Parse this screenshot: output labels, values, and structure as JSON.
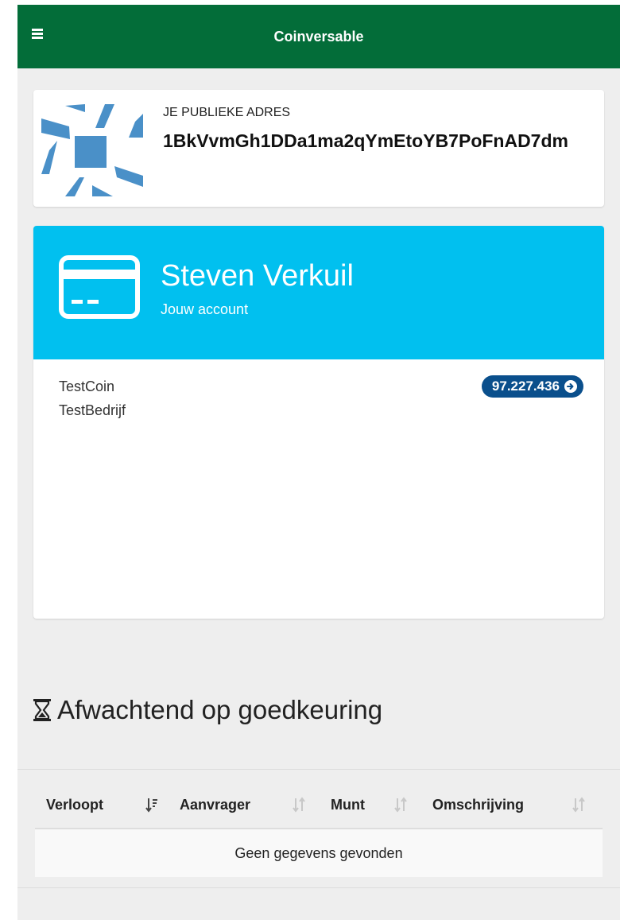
{
  "header": {
    "title": "Coinversable"
  },
  "address": {
    "label": "JE PUBLIEKE ADRES",
    "value": "1BkVvmGh1DDa1ma2qYmEtoYB7PoFnAD7dm"
  },
  "account": {
    "name": "Steven Verkuil",
    "subtitle": "Jouw account",
    "coin": "TestCoin",
    "company": "TestBedrijf",
    "balance": "97.227.436"
  },
  "pending": {
    "title": "Afwachtend op goedkeuring",
    "columns": [
      "Verloopt",
      "Aanvrager",
      "Munt",
      "Omschrijving"
    ],
    "empty_text": "Geen gegevens gevonden"
  },
  "colors": {
    "topbar": "#036d39",
    "account_header": "#01c0ef",
    "balance_badge": "#0a4f8c",
    "identicon": "#4a90c8"
  },
  "icons": {
    "menu": "hamburger-icon",
    "card": "credit-card-icon",
    "balance_arrow": "arrow-circle-right-icon",
    "pending": "hourglass-icon",
    "sort": "sort-icon"
  }
}
